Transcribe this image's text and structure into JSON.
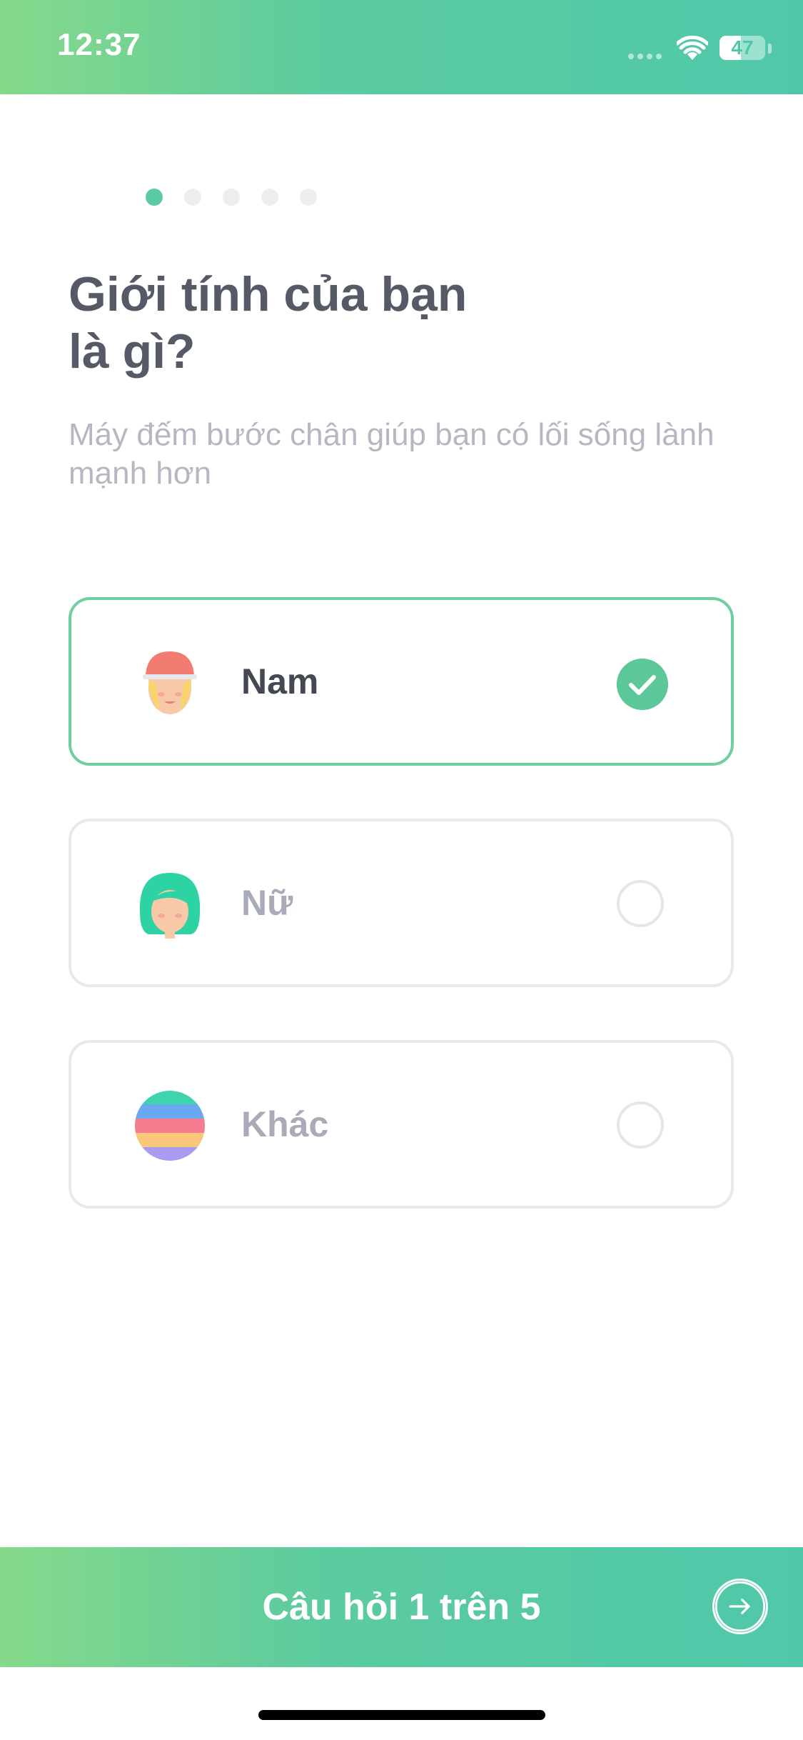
{
  "status_bar": {
    "time": "12:37",
    "battery_level": "47",
    "icons": [
      "signal-dots-icon",
      "wifi-icon",
      "battery-icon"
    ]
  },
  "progress": {
    "current_step": 1,
    "total_steps": 5
  },
  "title": "Giới tính của bạn là gì?",
  "subtitle": "Máy đếm bước chân giúp bạn có lối sống lành mạnh hơn",
  "options": [
    {
      "label": "Nam",
      "avatar": "male-avatar-icon",
      "selected": true
    },
    {
      "label": "Nữ",
      "avatar": "female-avatar-icon",
      "selected": false
    },
    {
      "label": "Khác",
      "avatar": "rainbow-avatar-icon",
      "selected": false
    }
  ],
  "footer": {
    "label": "Câu hỏi 1 trên 5",
    "next_icon": "arrow-right-circle-icon"
  },
  "colors": {
    "accent": "#5ccba3",
    "gradient_start": "#86d98a",
    "gradient_end": "#4fc8aa",
    "title_text": "#555a66",
    "muted_text": "#b5b8c2"
  }
}
